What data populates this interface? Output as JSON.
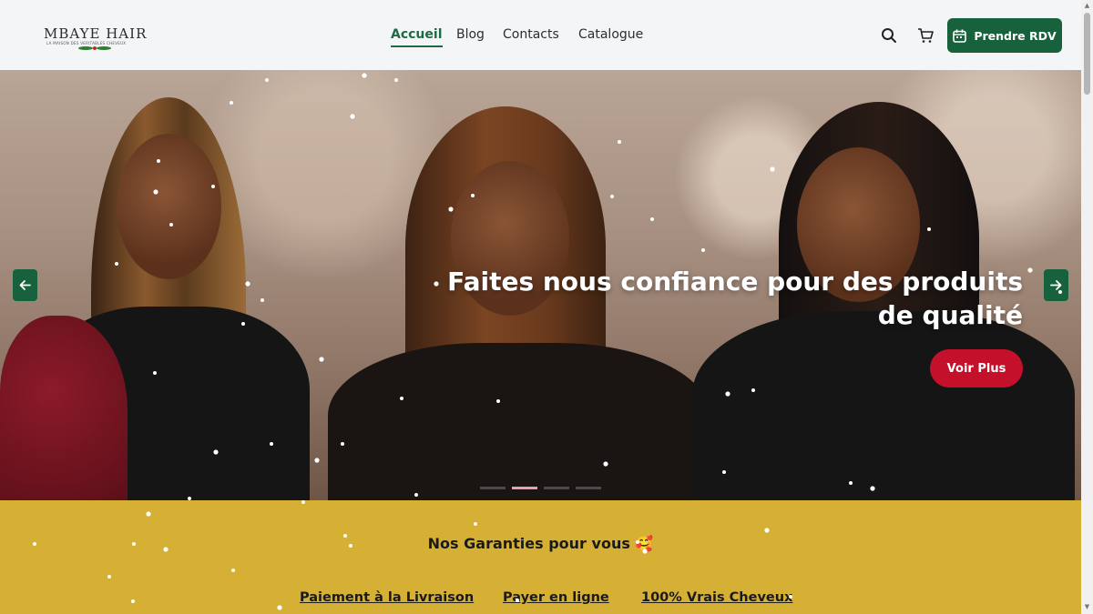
{
  "header": {
    "logo_text": "MBAYE HAIR",
    "logo_subtitle": "LA MAISON DES VERITABLES CHEVEUX",
    "nav": [
      {
        "label": "Accueil",
        "active": true
      },
      {
        "label": "Blog",
        "active": false
      },
      {
        "label": "Contacts",
        "active": false
      },
      {
        "label": "Catalogue",
        "active": false
      }
    ],
    "search_icon": "search-icon",
    "cart_icon": "cart-icon",
    "cta_label": "Prendre RDV",
    "cta_icon": "calendar-icon"
  },
  "hero": {
    "title_line1": "Faites nous confiance pour des produits",
    "title_line2": "de qualité",
    "button_label": "Voir Plus",
    "prev_icon": "arrow-left-icon",
    "next_icon": "arrow-right-icon",
    "slides_count": 4,
    "active_slide": 2
  },
  "guarantees": {
    "title": "Nos Garanties pour vous 🥰",
    "items": [
      "Paiement à la Livraison",
      "Payer en ligne",
      "100% Vrais Cheveux"
    ]
  },
  "colors": {
    "brand_green": "#17623c",
    "cta_red": "#c4102b",
    "guarantee_bg": "#d5b034",
    "header_bg": "#f4f5f7"
  }
}
